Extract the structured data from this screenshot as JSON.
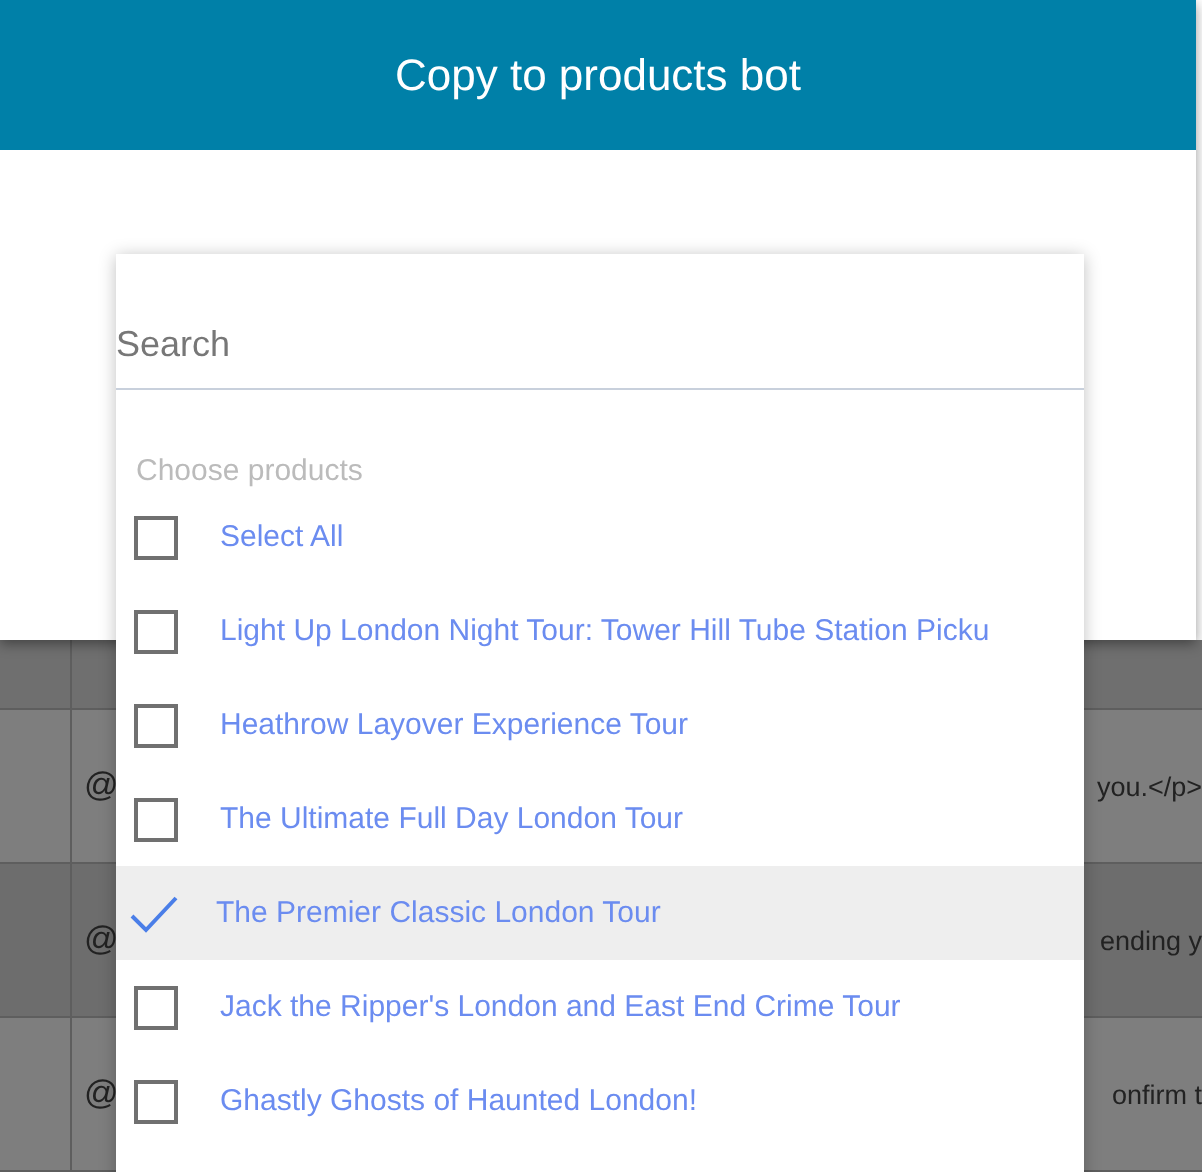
{
  "dialog": {
    "title": "Copy to products bot"
  },
  "search": {
    "placeholder": "Search"
  },
  "list_label": "Choose products",
  "select_all": {
    "label": "Select All",
    "checked": false
  },
  "products": [
    {
      "label": "Light Up London Night Tour: Tower Hill Tube Station Picku",
      "checked": false
    },
    {
      "label": "Heathrow Layover Experience Tour",
      "checked": false
    },
    {
      "label": "The Ultimate Full Day London Tour",
      "checked": false
    },
    {
      "label": "The Premier Classic London Tour",
      "checked": true
    },
    {
      "label": "Jack the Ripper's London and East End Crime Tour",
      "checked": false
    },
    {
      "label": "Ghastly Ghosts of Haunted London!",
      "checked": false
    }
  ],
  "background_table": {
    "rows": [
      {
        "column_2": "@",
        "column_3": "you.</p>"
      },
      {
        "column_2": "@",
        "column_3": "ending y"
      },
      {
        "column_2": "@",
        "column_3": "onfirm t"
      }
    ]
  }
}
